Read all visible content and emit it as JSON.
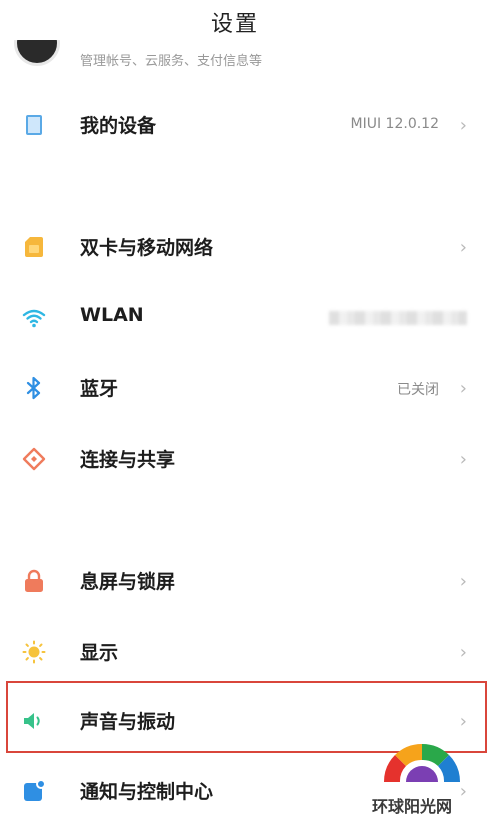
{
  "header": {
    "title": "设置"
  },
  "account": {
    "subtitle": "管理帐号、云服务、支付信息等"
  },
  "items": [
    {
      "label": "我的设备",
      "value": "MIUI 12.0.12",
      "icon": "device-icon",
      "color": "#5aa9e6"
    },
    {
      "label": "双卡与移动网络",
      "value": "",
      "icon": "sim-icon",
      "color": "#f6b73c"
    },
    {
      "label": "WLAN",
      "value": "",
      "icon": "wifi-icon",
      "color": "#2fb7e3"
    },
    {
      "label": "蓝牙",
      "value": "已关闭",
      "icon": "bluetooth-icon",
      "color": "#2f8fe3"
    },
    {
      "label": "连接与共享",
      "value": "",
      "icon": "share-icon",
      "color": "#ef7b5c"
    },
    {
      "label": "息屏与锁屏",
      "value": "",
      "icon": "lock-icon",
      "color": "#ef7b5c"
    },
    {
      "label": "显示",
      "value": "",
      "icon": "sun-icon",
      "color": "#f6c33c"
    },
    {
      "label": "声音与振动",
      "value": "",
      "icon": "speaker-icon",
      "color": "#37c28a"
    },
    {
      "label": "通知与控制中心",
      "value": "",
      "icon": "notification-icon",
      "color": "#2f8fe3"
    }
  ],
  "highlight_color": "#d9463b",
  "watermark": {
    "text": "环球阳光网"
  }
}
